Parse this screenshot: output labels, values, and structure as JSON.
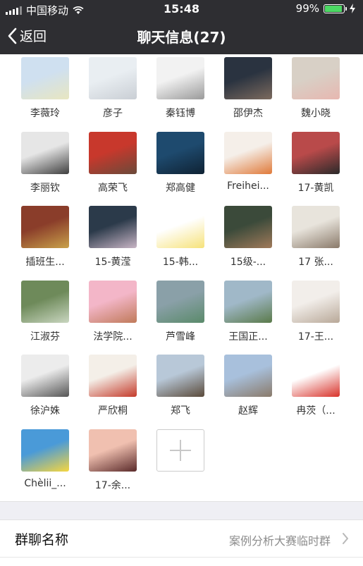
{
  "status": {
    "carrier": "中国移动",
    "time": "15:48",
    "battery_pct": "99%",
    "battery_level": 0.99
  },
  "nav": {
    "back_label": "返回",
    "title": "聊天信息(27)"
  },
  "members": [
    {
      "name": "李薇玲",
      "c1": "#cfe0f0",
      "c2": "#e8e6c0"
    },
    {
      "name": "彦子",
      "c1": "#e9eef2",
      "c2": "#c9ced4"
    },
    {
      "name": "秦钰博",
      "c1": "#f2f2f2",
      "c2": "#9a9a9a"
    },
    {
      "name": "邵伊杰",
      "c1": "#2a3340",
      "c2": "#7c6a5e"
    },
    {
      "name": "魏小晓",
      "c1": "#d8d0c6",
      "c2": "#e7b7b0"
    },
    {
      "name": "李丽钦",
      "c1": "#e6e6e6",
      "c2": "#3f3f3f"
    },
    {
      "name": "高荣飞",
      "c1": "#c8382c",
      "c2": "#6a4a3a"
    },
    {
      "name": "郑高健",
      "c1": "#1e4a6e",
      "c2": "#0f2233"
    },
    {
      "name": "Freihei...",
      "c1": "#f5efe9",
      "c2": "#e07a3a"
    },
    {
      "name": "17-黄凯",
      "c1": "#b94a4a",
      "c2": "#2a2a2a"
    },
    {
      "name": "插班生...",
      "c1": "#8a3d2a",
      "c2": "#c9a14a"
    },
    {
      "name": "15-黄滢",
      "c1": "#2b3a4a",
      "c2": "#c8b5c5"
    },
    {
      "name": "15-韩...",
      "c1": "#ffffff",
      "c2": "#f6e27a"
    },
    {
      "name": "15级-...",
      "c1": "#3b4a3a",
      "c2": "#a07a5a"
    },
    {
      "name": "17 张...",
      "c1": "#e8e4dc",
      "c2": "#8a7a6a"
    },
    {
      "name": "江淑芬",
      "c1": "#6e8a5a",
      "c2": "#c9d6c0"
    },
    {
      "name": "法学院...",
      "c1": "#f3b6c8",
      "c2": "#c07a5a"
    },
    {
      "name": "芦雪峰",
      "c1": "#8aa0a8",
      "c2": "#5a8a6a"
    },
    {
      "name": "王国正...",
      "c1": "#a0b8c8",
      "c2": "#5a7a4a"
    },
    {
      "name": "17-王...",
      "c1": "#f2eeea",
      "c2": "#b8a898"
    },
    {
      "name": "徐沪姝",
      "c1": "#ececec",
      "c2": "#555555"
    },
    {
      "name": "严欣桐",
      "c1": "#f4efe8",
      "c2": "#c43a2a"
    },
    {
      "name": "郑飞",
      "c1": "#b8c8d8",
      "c2": "#5a4a3a"
    },
    {
      "name": "赵辉",
      "c1": "#a8c0dc",
      "c2": "#8a7a6a"
    },
    {
      "name": "冉茨（...",
      "c1": "#ffffff",
      "c2": "#d8322a"
    },
    {
      "name": "Chèlii_...",
      "c1": "#4a9ad8",
      "c2": "#f6d640"
    },
    {
      "name": "17-余...",
      "c1": "#f0c0b0",
      "c2": "#5a2a2a"
    }
  ],
  "group_name_row": {
    "label": "群聊名称",
    "value": "案例分析大赛临时群"
  }
}
